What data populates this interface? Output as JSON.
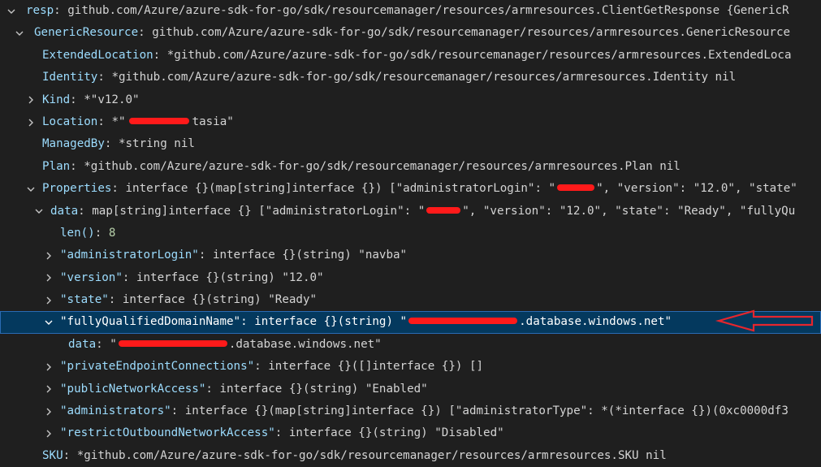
{
  "colors": {
    "background": "#1f1f1f",
    "key": "#9cdcfe",
    "value": "#d4d4d4",
    "number": "#b5cea8",
    "selected_row": "#04395e",
    "annotation_arrow": "#e5262d"
  },
  "rows": [
    {
      "twisty": "expanded",
      "key": "resp",
      "sep": ": ",
      "value": "github.com/Azure/azure-sdk-for-go/sdk/resourcemanager/resources/armresources.ClientGetResponse {GenericR"
    },
    {
      "twisty": "expanded",
      "key": "GenericResource",
      "sep": ": ",
      "value": "github.com/Azure/azure-sdk-for-go/sdk/resourcemanager/resources/armresources.GenericResource"
    },
    {
      "twisty": "none",
      "key": "ExtendedLocation",
      "sep": ": ",
      "value": "*github.com/Azure/azure-sdk-for-go/sdk/resourcemanager/resources/armresources.ExtendedLoca"
    },
    {
      "twisty": "none",
      "key": "Identity",
      "sep": ": ",
      "value": "*github.com/Azure/azure-sdk-for-go/sdk/resourcemanager/resources/armresources.Identity nil"
    },
    {
      "twisty": "collapsed",
      "key": "Kind",
      "sep": ": ",
      "value": "*\"v12.0\""
    },
    {
      "twisty": "collapsed",
      "key": "Location",
      "sep": ": ",
      "value": "*\"",
      "redact": 1,
      "value_after": "tasia\""
    },
    {
      "twisty": "none",
      "key": "ManagedBy",
      "sep": ": ",
      "value": "*string nil"
    },
    {
      "twisty": "none",
      "key": "Plan",
      "sep": ": ",
      "value": "*github.com/Azure/azure-sdk-for-go/sdk/resourcemanager/resources/armresources.Plan nil"
    },
    {
      "twisty": "expanded",
      "key": "Properties",
      "sep": ": ",
      "value": "interface {}(map[string]interface {}) [\"administratorLogin\": \"",
      "redact": 2,
      "value_after": "\", \"version\": \"12.0\", \"state\""
    },
    {
      "twisty": "expanded",
      "key": "data",
      "sep": ": ",
      "value": "map[string]interface {} [\"administratorLogin\": \"",
      "redact": 3,
      "value_after": "\", \"version\": \"12.0\", \"state\": \"Ready\", \"fullyQu"
    },
    {
      "twisty": "none",
      "key": "len()",
      "sep": ": ",
      "value": "8",
      "number": true
    },
    {
      "twisty": "collapsed",
      "key": "\"administratorLogin\"",
      "sep": ": ",
      "value": "interface {}(string) \"navba\""
    },
    {
      "twisty": "collapsed",
      "key": "\"version\"",
      "sep": ": ",
      "value": "interface {}(string) \"12.0\""
    },
    {
      "twisty": "collapsed",
      "key": "\"state\"",
      "sep": ": ",
      "value": "interface {}(string) \"Ready\""
    },
    {
      "twisty": "expanded",
      "key": "\"fullyQualifiedDomainName\"",
      "sep": ": ",
      "value": "interface {}(string) \"",
      "redact": 4,
      "value_after": ".database.windows.net\"",
      "selected": true
    },
    {
      "twisty": "none",
      "key": "data",
      "sep": ": ",
      "value": "\"",
      "redact": 5,
      "value_after": ".database.windows.net\""
    },
    {
      "twisty": "collapsed",
      "key": "\"privateEndpointConnections\"",
      "sep": ": ",
      "value": "interface {}([]interface {}) []"
    },
    {
      "twisty": "collapsed",
      "key": "\"publicNetworkAccess\"",
      "sep": ": ",
      "value": "interface {}(string) \"Enabled\""
    },
    {
      "twisty": "collapsed",
      "key": "\"administrators\"",
      "sep": ": ",
      "value": "interface {}(map[string]interface {}) [\"administratorType\": *(*interface {})(0xc0000df3"
    },
    {
      "twisty": "collapsed",
      "key": "\"restrictOutboundNetworkAccess\"",
      "sep": ": ",
      "value": "interface {}(string) \"Disabled\""
    },
    {
      "twisty": "none",
      "key": "SKU",
      "sep": ": ",
      "value": "*github.com/Azure/azure-sdk-for-go/sdk/resourcemanager/resources/armresources.SKU nil"
    }
  ]
}
